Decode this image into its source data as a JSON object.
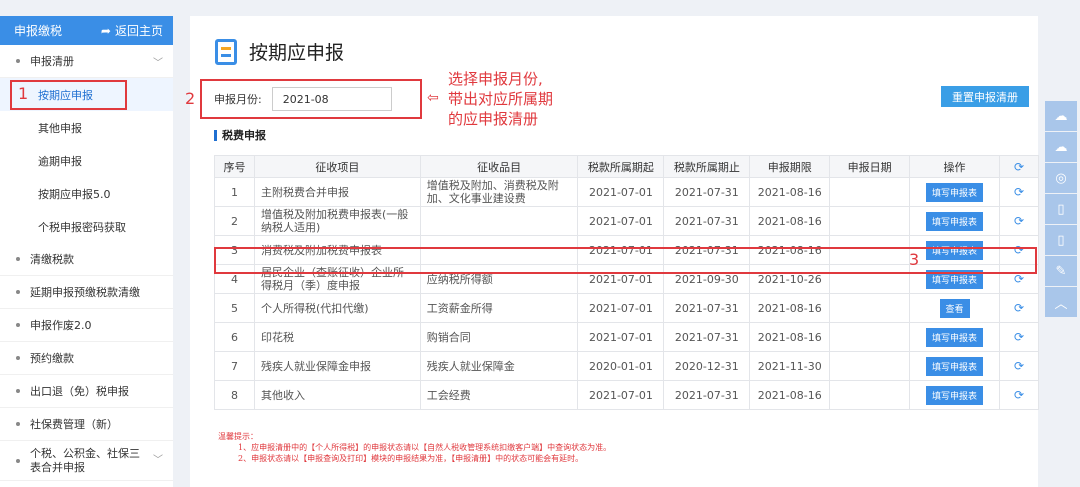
{
  "sidebar": {
    "header": "申报缴税",
    "back": "返回主页",
    "items": [
      {
        "label": "申报清册",
        "chevron": "﹀"
      },
      {
        "label": "按期应申报"
      },
      {
        "label": "其他申报"
      },
      {
        "label": "逾期申报"
      },
      {
        "label": "按期应申报5.0"
      },
      {
        "label": "个税申报密码获取"
      },
      {
        "label": "清缴税款"
      },
      {
        "label": "延期申报预缴税款清缴"
      },
      {
        "label": "申报作废2.0"
      },
      {
        "label": "预约缴款"
      },
      {
        "label": "出口退（免）税申报"
      },
      {
        "label": "社保费管理（新）"
      },
      {
        "label": "个税、公积金、社保三表合并申报"
      }
    ]
  },
  "main": {
    "title": "按期应申报",
    "month_label": "申报月份:",
    "month_value": "2021-08",
    "reset_button": "重置申报清册",
    "section_title": "税费申报",
    "columns": [
      "序号",
      "征收项目",
      "征收品目",
      "税款所属期起",
      "税款所属期止",
      "申报期限",
      "申报日期",
      "操作"
    ],
    "rows": [
      {
        "no": "1",
        "item": "主附税费合并申报",
        "sub": "增值税及附加、消费税及附加、文化事业建设费",
        "start": "2021-07-01",
        "end": "2021-07-31",
        "due": "2021-08-16",
        "date": "",
        "op": "填写申报表"
      },
      {
        "no": "2",
        "item": "增值税及附加税费申报表(一般纳税人适用)",
        "sub": "",
        "start": "2021-07-01",
        "end": "2021-07-31",
        "due": "2021-08-16",
        "date": "",
        "op": "填写申报表"
      },
      {
        "no": "3",
        "item": "消费税及附加税费申报表",
        "sub": "",
        "start": "2021-07-01",
        "end": "2021-07-31",
        "due": "2021-08-16",
        "date": "",
        "op": "填写申报表"
      },
      {
        "no": "4",
        "item": "居民企业（查账征收）企业所得税月（季）度申报",
        "sub": "应纳税所得额",
        "start": "2021-07-01",
        "end": "2021-09-30",
        "due": "2021-10-26",
        "date": "",
        "op": "填写申报表"
      },
      {
        "no": "5",
        "item": "个人所得税(代扣代缴)",
        "sub": "工资薪金所得",
        "start": "2021-07-01",
        "end": "2021-07-31",
        "due": "2021-08-16",
        "date": "",
        "op": "查看"
      },
      {
        "no": "6",
        "item": "印花税",
        "sub": "购销合同",
        "start": "2021-07-01",
        "end": "2021-07-31",
        "due": "2021-08-16",
        "date": "",
        "op": "填写申报表"
      },
      {
        "no": "7",
        "item": "残疾人就业保障金申报",
        "sub": "残疾人就业保障金",
        "start": "2020-01-01",
        "end": "2020-12-31",
        "due": "2021-11-30",
        "date": "",
        "op": "填写申报表"
      },
      {
        "no": "8",
        "item": "其他收入",
        "sub": "工会经费",
        "start": "2021-07-01",
        "end": "2021-07-31",
        "due": "2021-08-16",
        "date": "",
        "op": "填写申报表"
      }
    ],
    "hint_title": "温馨提示：",
    "hint_1": "1、应申报清册中的【个人所得税】的申报状态请以【自然人税收管理系统扣缴客户端】中查询状态为准。",
    "hint_2": "2、申报状态请以【申报查询及打印】模块的申报结果为准，【申报清册】中的状态可能会有延时。"
  },
  "annotations": {
    "n1": "1",
    "n2": "2",
    "n3": "3",
    "text_1": "选择申报月份,",
    "text_2": "带出对应所属期",
    "text_3": "的应申报清册",
    "arrow": "⇦"
  },
  "icons": {
    "refresh": "refresh-icon",
    "back": "back-arrow-icon"
  },
  "colors": {
    "primary": "#3a8ee6",
    "annotation": "#e0393e"
  }
}
